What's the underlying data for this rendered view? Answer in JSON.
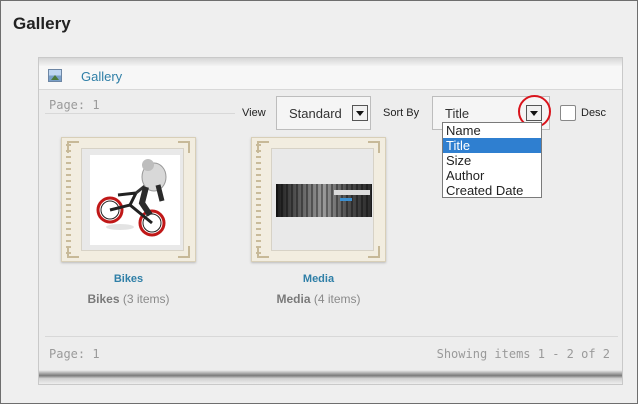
{
  "page": {
    "title": "Gallery"
  },
  "gallery": {
    "header_link": "Gallery",
    "page_top": "Page: 1",
    "view_label": "View",
    "view_value": "Standard",
    "sort_label": "Sort By",
    "sort_value": "Title",
    "desc_label": "Desc",
    "sort_options": [
      "Name",
      "Title",
      "Size",
      "Author",
      "Created Date"
    ],
    "selected_sort_index": 1,
    "items": [
      {
        "link": "Bikes",
        "name": "Bikes",
        "count": "(3 items)"
      },
      {
        "link": "Media",
        "name": "Media",
        "count": "(4 items)"
      }
    ],
    "page_bottom": "Page: 1",
    "showing": "Showing items 1 - 2 of 2"
  },
  "colors": {
    "link": "#2f7fa7",
    "highlight_circle": "#d9141c",
    "selected_option": "#2f7fd0"
  }
}
